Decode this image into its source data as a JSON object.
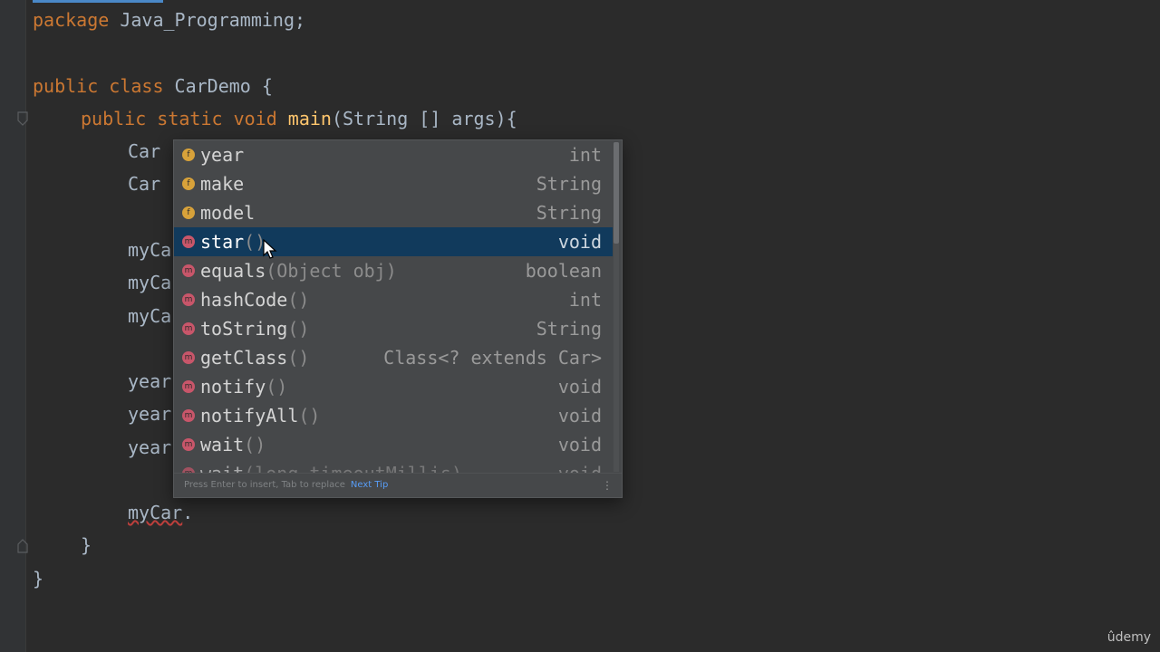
{
  "editor": {
    "lines": {
      "package_kw": "package",
      "package_name": " Java_Programming;",
      "class_public": "public",
      "class_kw": " class ",
      "class_name": "CarDemo {",
      "main_public": "public",
      "main_static": " static",
      "main_void": " void ",
      "main_name": "main",
      "main_params": "(String [] args){",
      "car1": "Car",
      "car2": "Car",
      "mycar1": "myCa",
      "mycar2": "myCa",
      "mycar3": "myCa",
      "year1": "year",
      "year2": "year",
      "year3": "year",
      "current": "myCar",
      "current_dot": ".",
      "close_method": "}",
      "close_class": "}"
    }
  },
  "completion": {
    "items": [
      {
        "kind": "field",
        "icon": "f",
        "name": "year",
        "params": "",
        "type": "int"
      },
      {
        "kind": "field",
        "icon": "f",
        "name": "make",
        "params": "",
        "type": "String"
      },
      {
        "kind": "field",
        "icon": "f",
        "name": "model",
        "params": "",
        "type": "String"
      },
      {
        "kind": "method",
        "icon": "m",
        "name": "star",
        "params": "()",
        "type": "void",
        "selected": true
      },
      {
        "kind": "method",
        "icon": "m",
        "name": "equals",
        "params": "(Object obj)",
        "type": "boolean"
      },
      {
        "kind": "method",
        "icon": "m",
        "name": "hashCode",
        "params": "()",
        "type": "int"
      },
      {
        "kind": "method",
        "icon": "m",
        "name": "toString",
        "params": "()",
        "type": "String"
      },
      {
        "kind": "method",
        "icon": "m",
        "name": "getClass",
        "params": "()",
        "type": "Class<? extends Car>"
      },
      {
        "kind": "method",
        "icon": "m",
        "name": "notify",
        "params": "()",
        "type": "void"
      },
      {
        "kind": "method",
        "icon": "m",
        "name": "notifyAll",
        "params": "()",
        "type": "void"
      },
      {
        "kind": "method",
        "icon": "m",
        "name": "wait",
        "params": "()",
        "type": "void"
      },
      {
        "kind": "method",
        "icon": "m",
        "name": "wait",
        "params": "(long timeoutMillis)",
        "type": "void"
      }
    ],
    "footer_hint": "Press Enter to insert, Tab to replace",
    "footer_tip": "Next Tip",
    "footer_menu": "⋮"
  },
  "watermark": "ûdemy",
  "colors": {
    "background": "#2b2b2b",
    "keyword": "#cc7832",
    "method_name": "#ffc66d",
    "popup": "#46484a",
    "selection": "#113a5c"
  }
}
